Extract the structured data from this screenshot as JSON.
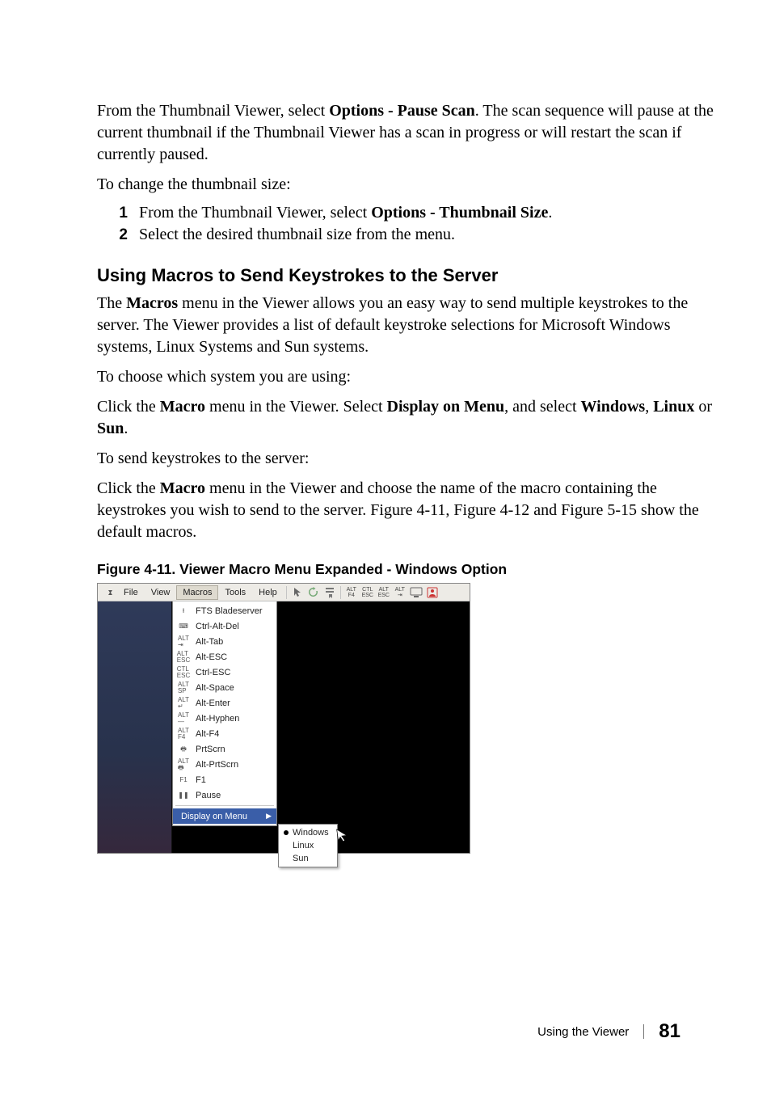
{
  "para1_pre": "From the Thumbnail Viewer, select ",
  "para1_bold": "Options - Pause Scan",
  "para1_post": ". The scan sequence will pause at the current thumbnail if the Thumbnail Viewer has a scan in progress or will restart the scan if currently paused.",
  "para2": "To change the thumbnail size:",
  "step1_pre": "From the Thumbnail Viewer, select ",
  "step1_bold": "Options - Thumbnail Size",
  "step1_post": ".",
  "step2": "Select the desired thumbnail size from the menu.",
  "num1": "1",
  "num2": "2",
  "heading": "Using Macros to Send Keystrokes to the Server",
  "para3_pre": "The ",
  "para3_bold": "Macros",
  "para3_post": " menu in the Viewer allows you an easy way to send multiple keystrokes to the server. The Viewer provides a list of default keystroke selections for Microsoft Windows systems, Linux Systems and Sun systems.",
  "para4": "To choose which system you are using:",
  "para5_a": "Click the ",
  "para5_b": "Macro",
  "para5_c": " menu in the Viewer. Select ",
  "para5_d": "Display on Menu",
  "para5_e": ", and select ",
  "para5_f": "Windows",
  "para5_g": ", ",
  "para5_h": "Linux",
  "para5_i": " or ",
  "para5_j": "Sun",
  "para5_k": ".",
  "para6": "To send keystrokes to the server:",
  "para7_a": "Click the ",
  "para7_b": "Macro",
  "para7_c": " menu in the Viewer and choose the name of the macro containing the keystrokes you wish to send to the server. Figure 4-11, Figure 4-12 and Figure 5-15 show the default macros.",
  "figcaption": "Figure 4-11.    Viewer Macro Menu Expanded - Windows Option",
  "menubar": {
    "file": "File",
    "view": "View",
    "macros": "Macros",
    "tools": "Tools",
    "help": "Help",
    "shortcuts": {
      "f4": "ALT\nF4",
      "cesc": "CTL\nESC",
      "aesc": "ALT\nESC",
      "atab": "ALT\n⇥"
    }
  },
  "macros_menu": {
    "items": [
      {
        "ico": "⭱",
        "label": "FTS Bladeserver"
      },
      {
        "ico": "⌨",
        "label": "Ctrl-Alt-Del"
      },
      {
        "ico": "ALT\n⇥",
        "label": "Alt-Tab"
      },
      {
        "ico": "ALT\nESC",
        "label": "Alt-ESC"
      },
      {
        "ico": "CTL\nESC",
        "label": "Ctrl-ESC"
      },
      {
        "ico": "ALT\nSP",
        "label": "Alt-Space"
      },
      {
        "ico": "ALT\n↵",
        "label": "Alt-Enter"
      },
      {
        "ico": "ALT\n—",
        "label": "Alt-Hyphen"
      },
      {
        "ico": "ALT\nF4",
        "label": "Alt-F4"
      },
      {
        "ico": "🖶",
        "label": "PrtScrn"
      },
      {
        "ico": "ALT\n🖶",
        "label": "Alt-PrtScrn"
      },
      {
        "ico": "F1",
        "label": "F1"
      },
      {
        "ico": "❚❚",
        "label": "Pause"
      }
    ],
    "display_on_menu": "Display on Menu",
    "submenu": {
      "windows": "Windows",
      "linux": "Linux",
      "sun": "Sun"
    }
  },
  "footer": {
    "text": "Using the Viewer",
    "page": "81"
  }
}
